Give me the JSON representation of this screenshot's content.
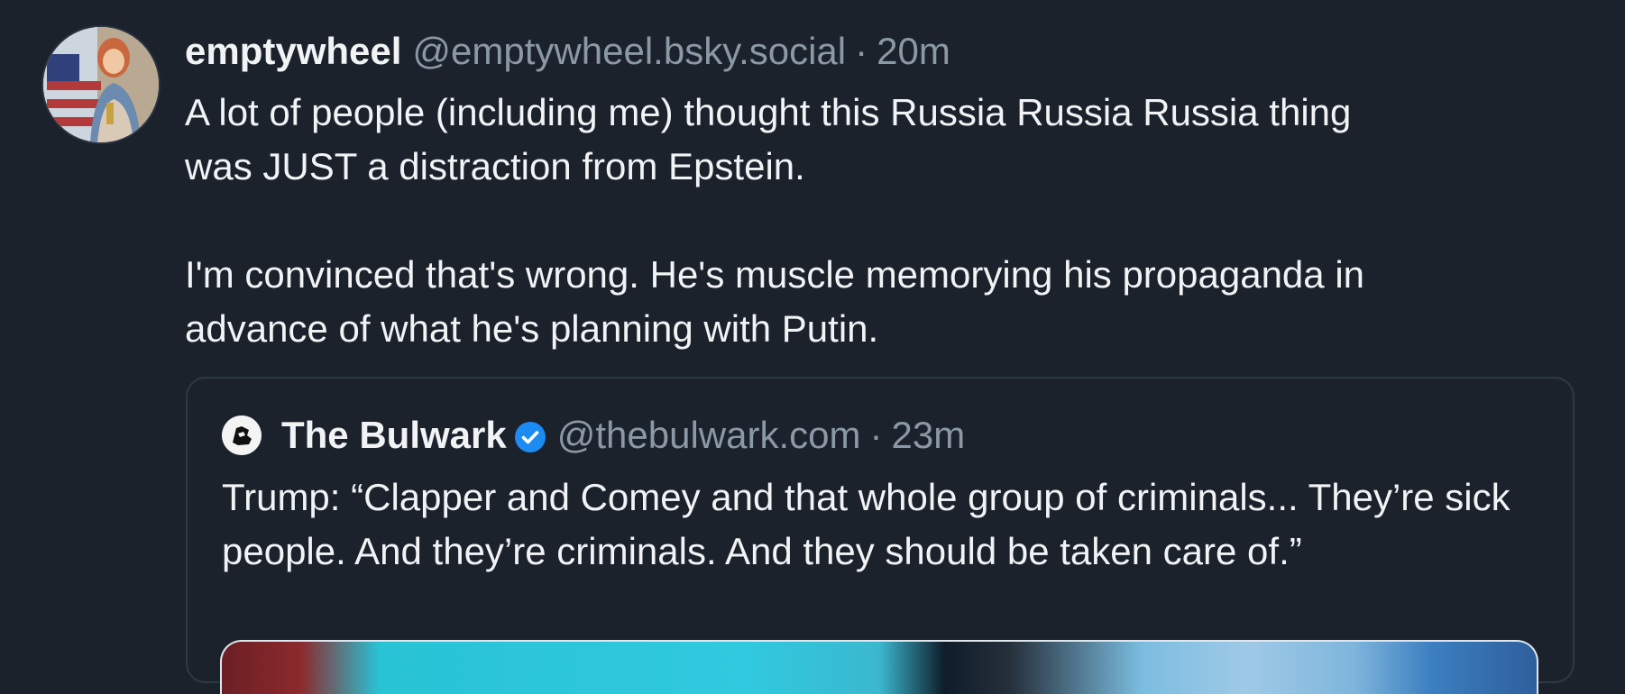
{
  "post": {
    "author": {
      "display_name": "emptywheel",
      "handle": "@emptywheel.bsky.social",
      "separator": "·",
      "time": "20m"
    },
    "text": "A lot of people (including me) thought this Russia Russia Russia thing\nwas JUST a distraction from Epstein.\n\nI'm convinced that's wrong. He's muscle memorying his propaganda in\nadvance of what he's planning with Putin."
  },
  "quote": {
    "author": {
      "display_name": "The Bulwark",
      "handle": "@thebulwark.com",
      "separator": "·",
      "time": "23m",
      "verified": true
    },
    "text": "Trump: “Clapper and Comey and that whole group of criminals... They’re sick people. And they’re criminals. And they should be taken care of.”"
  },
  "colors": {
    "background": "#1b222c",
    "primary_text": "#f1f3f5",
    "secondary_text": "#8b98a5",
    "verified_badge": "#1d8cf2",
    "card_border": "#2e3946"
  },
  "icons": {
    "verified": "verified-badge-icon",
    "quote_avatar": "bulwark-logo-icon"
  }
}
